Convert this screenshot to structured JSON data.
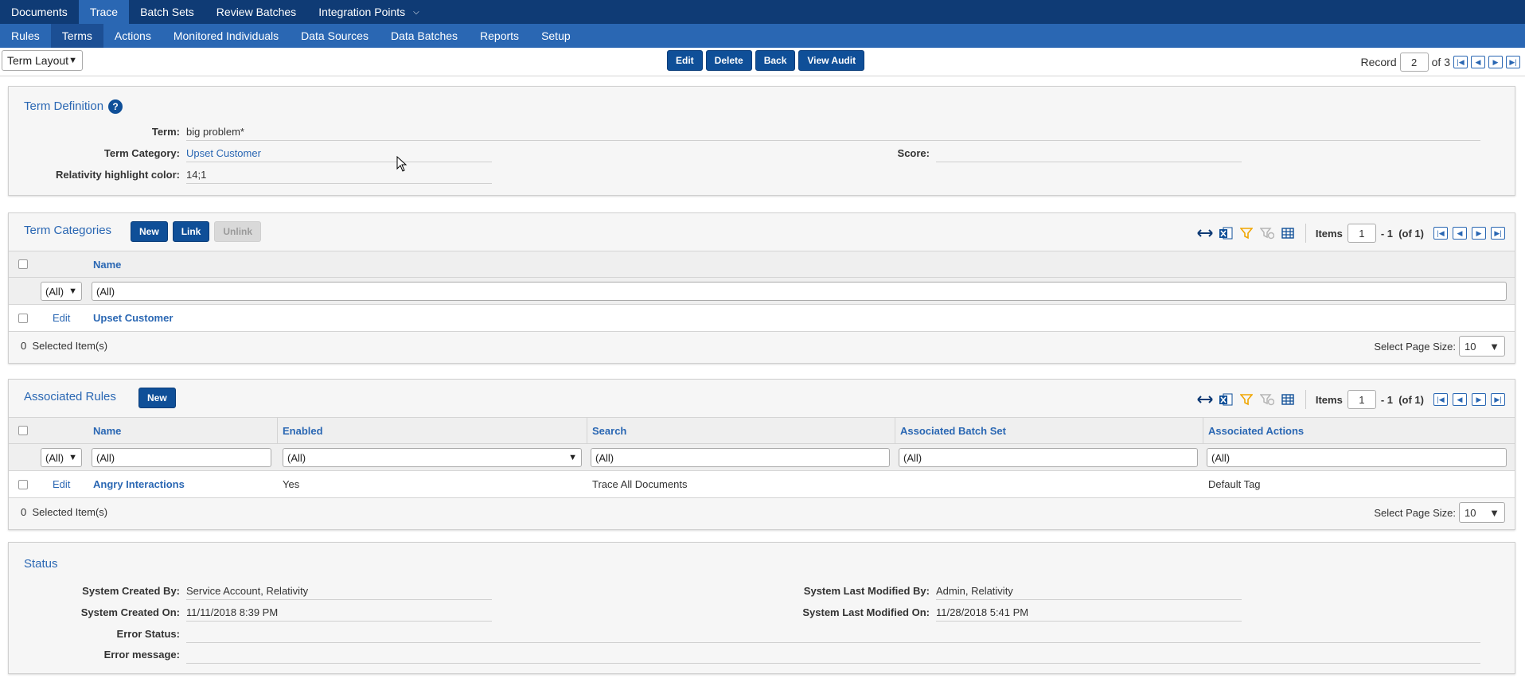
{
  "topnav": {
    "tabs": [
      {
        "label": "Documents",
        "active": false
      },
      {
        "label": "Trace",
        "active": true
      },
      {
        "label": "Batch Sets",
        "active": false
      },
      {
        "label": "Review Batches",
        "active": false
      },
      {
        "label": "Integration Points",
        "active": false
      }
    ]
  },
  "subnav": {
    "tabs": [
      {
        "label": "Rules",
        "active": false
      },
      {
        "label": "Terms",
        "active": true
      },
      {
        "label": "Actions",
        "active": false
      },
      {
        "label": "Monitored Individuals",
        "active": false
      },
      {
        "label": "Data Sources",
        "active": false
      },
      {
        "label": "Data Batches",
        "active": false
      },
      {
        "label": "Reports",
        "active": false
      },
      {
        "label": "Setup",
        "active": false
      }
    ]
  },
  "toolbar": {
    "layout_select": "Term Layout",
    "edit_label": "Edit",
    "delete_label": "Delete",
    "back_label": "Back",
    "view_audit_label": "View Audit",
    "record_label": "Record",
    "record_current": "2",
    "record_of": "of 3"
  },
  "term_definition": {
    "title": "Term Definition",
    "help_glyph": "?",
    "term_label": "Term:",
    "term_value": "big problem*",
    "category_label": "Term Category:",
    "category_value": "Upset Customer",
    "score_label": "Score:",
    "score_value": "",
    "color_label": "Relativity highlight color:",
    "color_value": "14;1"
  },
  "term_categories": {
    "title": "Term Categories",
    "new_label": "New",
    "link_label": "Link",
    "unlink_label": "Unlink",
    "items_label": "Items",
    "items_start": "1",
    "items_range": "- 1  (of 1)",
    "columns": [
      "Name"
    ],
    "filter_all": "(All)",
    "name_filter": "(All)",
    "rows": [
      {
        "edit": "Edit",
        "name": "Upset Customer"
      }
    ],
    "selected_count": "0",
    "selected_label": "Selected Item(s)",
    "page_size_label": "Select Page Size:",
    "page_size": "10"
  },
  "associated_rules": {
    "title": "Associated Rules",
    "new_label": "New",
    "items_label": "Items",
    "items_start": "1",
    "items_range": "- 1  (of 1)",
    "columns": [
      "Name",
      "Enabled",
      "Search",
      "Associated Batch Set",
      "Associated Actions"
    ],
    "filter_all": "(All)",
    "filters": [
      "(All)",
      "(All)",
      "(All)",
      "(All)",
      "(All)"
    ],
    "rows": [
      {
        "edit": "Edit",
        "name": "Angry Interactions",
        "enabled": "Yes",
        "search": "Trace All Documents",
        "batch_set": "",
        "actions": "Default Tag"
      }
    ],
    "selected_count": "0",
    "selected_label": "Selected Item(s)",
    "page_size_label": "Select Page Size:",
    "page_size": "10"
  },
  "status": {
    "title": "Status",
    "created_by_label": "System Created By:",
    "created_by_value": "Service Account, Relativity",
    "created_on_label": "System Created On:",
    "created_on_value": "11/11/2018 8:39 PM",
    "modified_by_label": "System Last Modified By:",
    "modified_by_value": "Admin, Relativity",
    "modified_on_label": "System Last Modified On:",
    "modified_on_value": "11/28/2018 5:41 PM",
    "error_status_label": "Error Status:",
    "error_status_value": "",
    "error_message_label": "Error message:",
    "error_message_value": ""
  },
  "colors": {
    "nav_dark": "#0f3b75",
    "nav_blue": "#2a67b3",
    "button": "#0f4f98",
    "link": "#2a67b3",
    "filter_icon": "#f0a500"
  },
  "icons": {
    "expand": "arrows-horizontal-icon",
    "excel": "excel-export-icon",
    "filter": "filter-icon",
    "clear_filter": "clear-filter-icon",
    "columns": "grid-columns-icon",
    "first": "first-page-icon",
    "prev": "prev-page-icon",
    "next": "next-page-icon",
    "last": "last-page-icon"
  }
}
